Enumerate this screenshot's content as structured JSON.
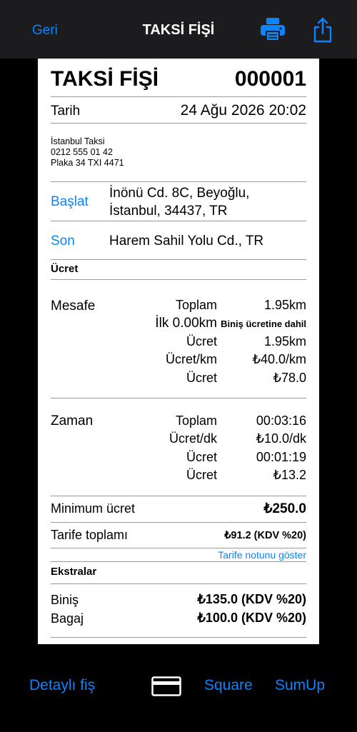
{
  "nav": {
    "back": "Geri",
    "title": "TAKSİ FİŞİ",
    "print_icon": "printer-icon",
    "share_icon": "share-icon"
  },
  "receipt": {
    "title": "TAKSİ FİŞİ",
    "number": "000001",
    "date_label": "Tarih",
    "date_value": "24 Ağu 2026 20:02",
    "company": [
      "İstanbul Taksi",
      "0212 555 01 42",
      "Plaka 34 TXI 4471"
    ],
    "start_label": "Başlat",
    "start_address": [
      "İnönü Cd. 8C, Beyoğlu,",
      "İstanbul, 34437, TR"
    ],
    "end_label": "Son",
    "end_address": "Harem Sahil Yolu Cd., TR",
    "fare_section": "Ücret",
    "distance": {
      "label": "Mesafe",
      "rows": [
        {
          "k": "Toplam",
          "v": "1.95km"
        },
        {
          "k": "İlk 0.00km",
          "v": "Biniş ücretine dahil"
        },
        {
          "k": "Ücret",
          "v": "1.95km"
        },
        {
          "k": "Ücret/km",
          "v": "₺40.0/km"
        },
        {
          "k": "Ücret",
          "v": "₺78.0"
        }
      ]
    },
    "time": {
      "label": "Zaman",
      "rows": [
        {
          "k": "Toplam",
          "v": "00:03:16"
        },
        {
          "k": "Ücret/dk",
          "v": "₺10.0/dk"
        },
        {
          "k": "Ücret",
          "v": "00:01:19"
        },
        {
          "k": "Ücret",
          "v": "₺13.2"
        }
      ]
    },
    "minimum_label": "Minimum ücret",
    "minimum_value": "₺250.0",
    "tariff_label": "Tarife toplamı",
    "tariff_value": "₺91.2 (KDV %20)",
    "tariff_note_link": "Tarife notunu göster",
    "extras_section": "Ekstralar",
    "extras": [
      {
        "k": "Biniş",
        "v": "₺135.0 (KDV %20)"
      },
      {
        "k": "Bagaj",
        "v": "₺100.0 (KDV %20)"
      }
    ]
  },
  "bottom": {
    "detailed": "Detaylı fiş",
    "card_icon": "credit-card-icon",
    "square": "Square",
    "sumup": "SumUp"
  },
  "colors": {
    "accent": "#0a84ff",
    "topbar": "#1c1c1e",
    "background": "#000000",
    "paper": "#ffffff"
  }
}
